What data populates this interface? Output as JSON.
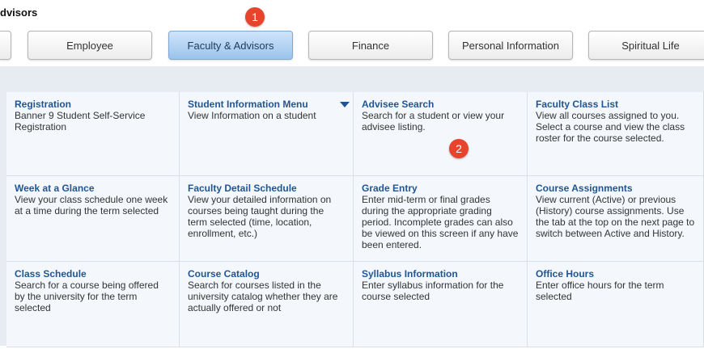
{
  "breadcrumb": "dvisors",
  "tabs": [
    {
      "label": ""
    },
    {
      "label": "Employee"
    },
    {
      "label": "Faculty & Advisors"
    },
    {
      "label": "Finance"
    },
    {
      "label": "Personal Information"
    },
    {
      "label": "Spiritual Life"
    }
  ],
  "badges": {
    "one": "1",
    "two": "2"
  },
  "cards": [
    {
      "title": "Registration",
      "desc": "Banner 9 Student Self-Service Registration"
    },
    {
      "title": "Student Information Menu",
      "desc": "View Information on a student"
    },
    {
      "title": "Advisee Search",
      "desc": "Search for a student or view your advisee listing."
    },
    {
      "title": "Faculty Class List",
      "desc": "View all courses assigned to you. Select a course and view the class roster for the course selected."
    },
    {
      "title": "Week at a Glance",
      "desc": "View your class schedule one week at a time during the term selected"
    },
    {
      "title": "Faculty Detail Schedule",
      "desc": "View your detailed information on courses being taught during the term selected (time, location, enrollment, etc.)"
    },
    {
      "title": "Grade Entry",
      "desc": "Enter mid-term or final grades during the appropriate grading period. Incomplete grades can also be viewed on this screen if any have been entered."
    },
    {
      "title": "Course Assignments",
      "desc": "View current (Active) or previous (History) course assignments. Use the tab at the top on the next page to switch between Active and History."
    },
    {
      "title": "Class Schedule",
      "desc": "Search for a course being offered by the university for the term selected"
    },
    {
      "title": "Course Catalog",
      "desc": "Search for courses listed in the university catalog whether they are actually offered or not"
    },
    {
      "title": "Syllabus Information",
      "desc": "Enter syllabus information for the course selected"
    },
    {
      "title": "Office Hours",
      "desc": "Enter office hours for the term selected"
    }
  ]
}
